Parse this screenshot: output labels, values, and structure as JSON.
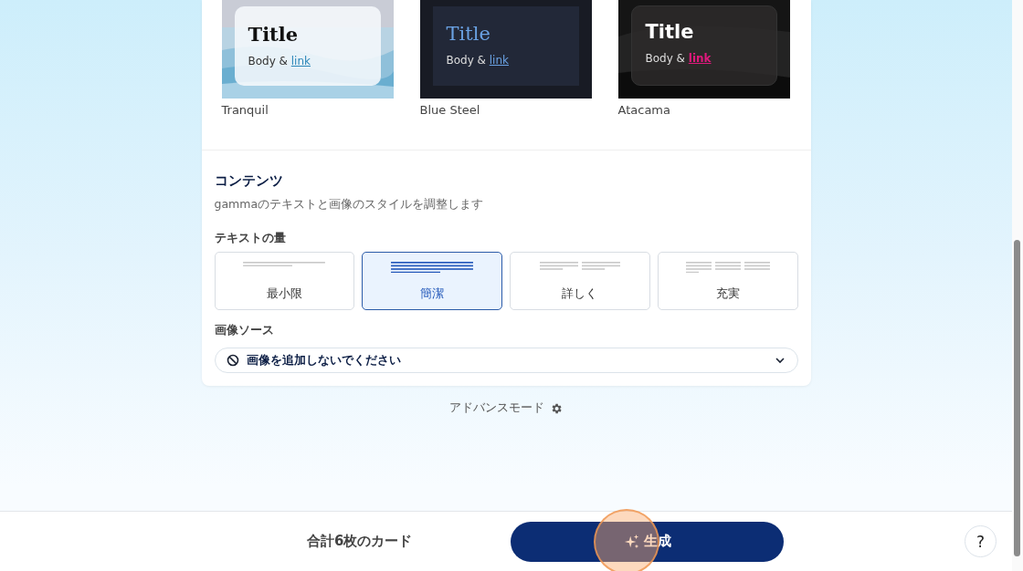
{
  "themes": [
    {
      "name": "Tranquil",
      "kind": "light-glass",
      "preview_title": "Title",
      "preview_body": "Body & ",
      "preview_link": "link"
    },
    {
      "name": "Blue Steel",
      "kind": "dark-flat",
      "preview_title": "Title",
      "preview_body": "Body & ",
      "preview_link": "link"
    },
    {
      "name": "Atacama",
      "kind": "dark-glass",
      "preview_title": "Title",
      "preview_body": "Body & ",
      "preview_link": "link"
    }
  ],
  "content": {
    "heading": "コンテンツ",
    "description": "gammaのテキストと画像のスタイルを調整します",
    "text_amount": {
      "label": "テキストの量",
      "options": [
        {
          "label": "最小限",
          "kind": "minimal",
          "selected": false
        },
        {
          "label": "簡潔",
          "kind": "concise",
          "selected": true
        },
        {
          "label": "詳しく",
          "kind": "detailed",
          "selected": false
        },
        {
          "label": "充実",
          "kind": "full",
          "selected": false
        }
      ]
    },
    "image_source": {
      "label": "画像ソース",
      "value": "画像を追加しないでください"
    }
  },
  "advanced_mode": "アドバンスモード",
  "footer": {
    "card_count": "合計6枚のカード",
    "generate_button": "生成",
    "help_button": "?"
  }
}
